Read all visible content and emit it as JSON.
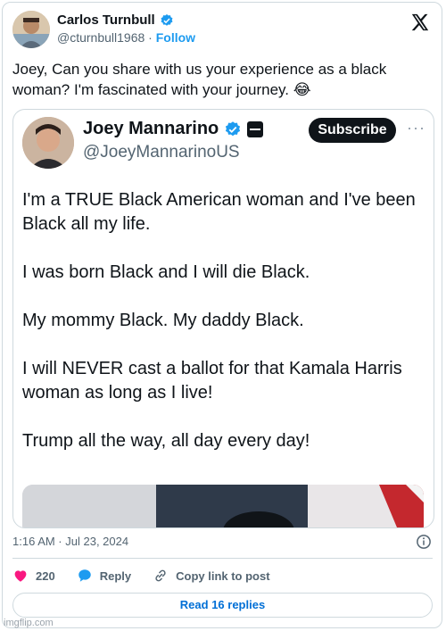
{
  "header": {
    "display_name": "Carlos Turnbull",
    "handle": "@cturnbull1968",
    "separator": "·",
    "follow_label": "Follow"
  },
  "tweet": {
    "text": "Joey, Can you share with us your experience as a black woman? I'm fascinated with your journey. 😂"
  },
  "quoted": {
    "display_name": "Joey Mannarino",
    "handle": "@JoeyMannarinoUS",
    "subscribe_label": "Subscribe",
    "more_label": "···",
    "paragraphs": [
      "I'm a TRUE Black American woman and I've been Black all my life.",
      "I was born Black and I will die Black.",
      "My mommy Black. My daddy Black.",
      "I will NEVER cast a ballot for that Kamala Harris woman as long as I live!",
      "Trump all the way, all day every day!"
    ]
  },
  "footer": {
    "timestamp": "1:16 AM · Jul 23, 2024",
    "like_count": "220",
    "reply_label": "Reply",
    "copy_label": "Copy link to post",
    "read_replies_label": "Read 16 replies"
  },
  "watermark": "imgflip.com",
  "colors": {
    "accent": "#1d9bf0",
    "like": "#f91880",
    "text": "#0f1419",
    "muted": "#536471"
  },
  "icons": [
    "verified-badge-icon",
    "x-logo-icon",
    "info-icon",
    "heart-icon",
    "reply-bubble-icon",
    "link-icon"
  ]
}
